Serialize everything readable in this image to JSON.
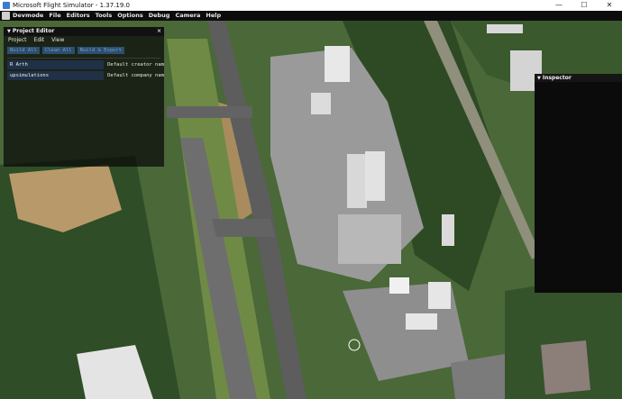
{
  "window": {
    "title": "Microsoft Flight Simulator - 1.37.19.0",
    "controls": [
      "—",
      "☐",
      "✕"
    ]
  },
  "menubar": {
    "items": [
      "Devmode",
      "File",
      "Editors",
      "Tools",
      "Options",
      "Debug",
      "Camera",
      "Help"
    ]
  },
  "project_editor": {
    "title": "Project Editor",
    "close": "×",
    "menu": [
      "Project",
      "Edit",
      "View"
    ],
    "buttons": [
      "Build All",
      "Clean All",
      "Build & Export"
    ],
    "fields": [
      {
        "value": "R Arth",
        "label": "Default creator nam"
      },
      {
        "value": "upsimulations",
        "label": "Default company nam"
      }
    ]
  },
  "inspector": {
    "title": "Inspector"
  },
  "colors": {
    "accent_button": "#2c4f70",
    "field_bg": "#1f3047"
  }
}
